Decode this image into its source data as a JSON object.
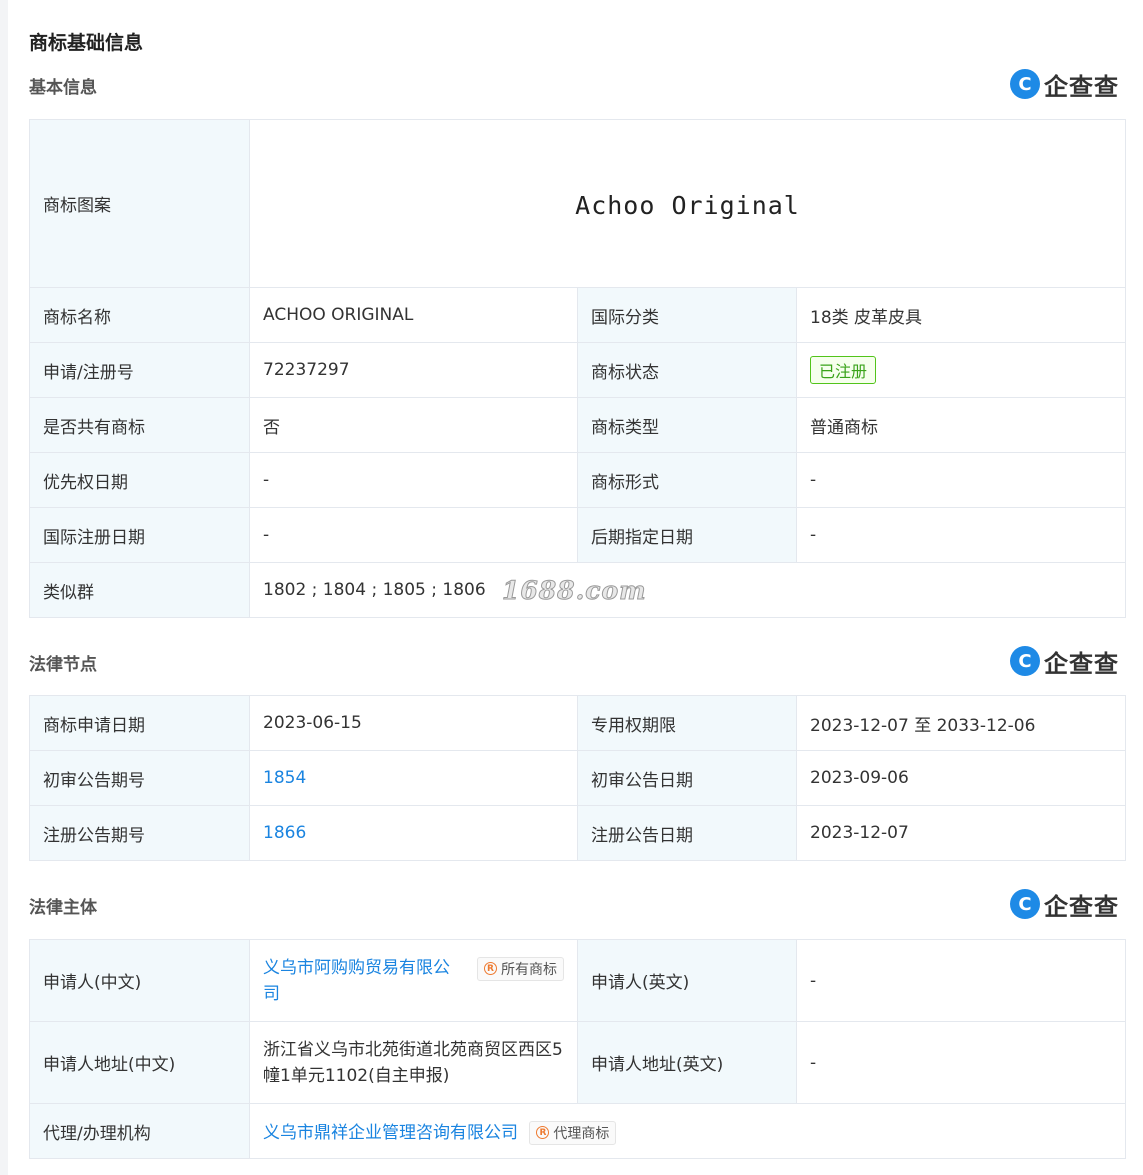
{
  "page_title": "商标基础信息",
  "brand": {
    "icon_letter": "C",
    "name": "企查查"
  },
  "basic": {
    "title": "基本信息",
    "mark_label": "商标图案",
    "mark_text": "Achoo Original",
    "rows": [
      {
        "l1": "商标名称",
        "v1": "ACHOO ORIGINAL",
        "l2": "国际分类",
        "v2": "18类 皮革皮具"
      },
      {
        "l1": "申请/注册号",
        "v1": "72237297",
        "l2": "商标状态",
        "v2": "已注册"
      },
      {
        "l1": "是否共有商标",
        "v1": "否",
        "l2": "商标类型",
        "v2": "普通商标"
      },
      {
        "l1": "优先权日期",
        "v1": "-",
        "l2": "商标形式",
        "v2": "-"
      },
      {
        "l1": "国际注册日期",
        "v1": "-",
        "l2": "后期指定日期",
        "v2": "-"
      }
    ],
    "similar_label": "类似群",
    "similar_value": "1802 ; 1804 ; 1805 ; 1806"
  },
  "watermark": "1688.com",
  "legal_nodes": {
    "title": "法律节点",
    "rows": [
      {
        "l1": "商标申请日期",
        "v1": "2023-06-15",
        "l2": "专用权期限",
        "v2": "2023-12-07 至 2033-12-06"
      },
      {
        "l1": "初审公告期号",
        "v1": "1854",
        "l2": "初审公告日期",
        "v2": "2023-09-06"
      },
      {
        "l1": "注册公告期号",
        "v1": "1866",
        "l2": "注册公告日期",
        "v2": "2023-12-07"
      }
    ]
  },
  "legal_entity": {
    "title": "法律主体",
    "applicant_cn_label": "申请人(中文)",
    "applicant_cn": "义乌市阿购购贸易有限公司",
    "applicant_tag": "所有商标",
    "applicant_en_label": "申请人(英文)",
    "applicant_en": "-",
    "addr_cn_label": "申请人地址(中文)",
    "addr_cn": "浙江省义乌市北苑街道北苑商贸区西区5幢1单元1102(自主申报)",
    "addr_en_label": "申请人地址(英文)",
    "addr_en": "-",
    "agent_label": "代理/办理机构",
    "agent": "义乌市鼎祥企业管理咨询有限公司",
    "agent_tag": "代理商标"
  },
  "colors": {
    "label_bg": "#f2f9fc",
    "border": "#e4e8ee",
    "link": "#1a84e0",
    "status": "#52c41a",
    "brand": "#1e8ae6"
  }
}
